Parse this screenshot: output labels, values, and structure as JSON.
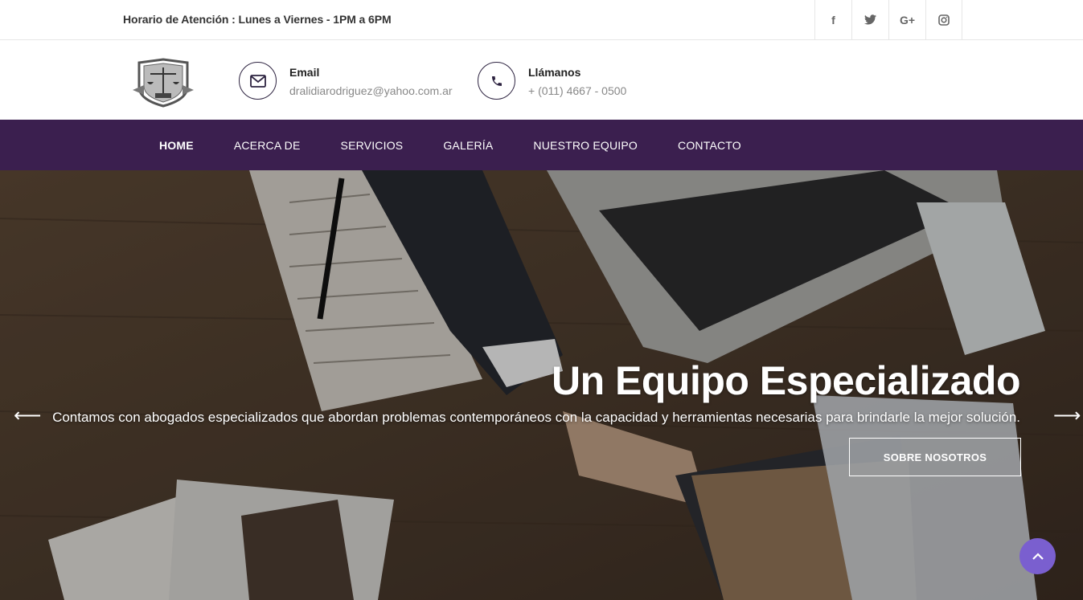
{
  "topbar": {
    "hours": "Horario de Atención : Lunes a Viernes - 1PM a 6PM",
    "social": [
      {
        "icon": "facebook-icon",
        "glyph": "f"
      },
      {
        "icon": "twitter-icon",
        "glyph": "t"
      },
      {
        "icon": "google-plus-icon",
        "glyph": "G+"
      },
      {
        "icon": "instagram-icon",
        "glyph": "◎"
      }
    ]
  },
  "header": {
    "email": {
      "label": "Email",
      "value": "dralidiarodriguez@yahoo.com.ar"
    },
    "phone": {
      "label": "Llámanos",
      "value": "+ (011) 4667 - 0500"
    }
  },
  "nav": {
    "items": [
      "HOME",
      "ACERCA DE",
      "SERVICIOS",
      "GALERÍA",
      "NUESTRO EQUIPO",
      "CONTACTO"
    ],
    "active": "HOME",
    "background": "#3b1f4f"
  },
  "hero": {
    "title": "Un Equipo Especializado",
    "subtitle": "Contamos con abogados especializados que abordan problemas contemporáneos con la capacidad y herramientas necesarias para brindarle la mejor solución.",
    "button": "SOBRE NOSOTROS",
    "prev_arrow": "⟵",
    "next_arrow": "⟶"
  },
  "colors": {
    "accent": "#7a5fcf",
    "nav": "#3b1f4f"
  }
}
